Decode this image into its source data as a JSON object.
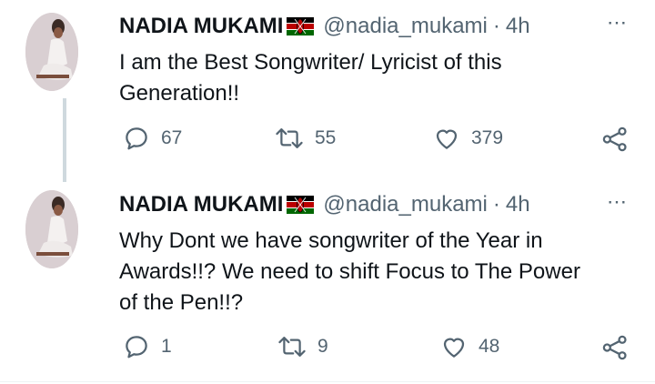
{
  "colors": {
    "text": "#0f1419",
    "secondary": "#536471",
    "thread_line": "#cfd9de"
  },
  "tweets": [
    {
      "author": {
        "name": "NADIA MUKAMI",
        "flag": "kenya-flag-emoji",
        "handle": "@nadia_mukami"
      },
      "separator": "·",
      "time": "4h",
      "more_icon": "⋯",
      "lines": [
        "I am the Best Songwriter/ Lyricist of this",
        "Generation!!"
      ],
      "stats": {
        "replies": "67",
        "retweets": "55",
        "likes": "379"
      }
    },
    {
      "author": {
        "name": "NADIA MUKAMI",
        "flag": "kenya-flag-emoji",
        "handle": "@nadia_mukami"
      },
      "separator": "·",
      "time": "4h",
      "more_icon": "⋯",
      "lines": [
        "Why Dont we have songwriter of the Year in",
        "Awards!!? We need to shift Focus to The Power",
        "of the Pen!!?"
      ],
      "stats": {
        "replies": "1",
        "retweets": "9",
        "likes": "48"
      }
    }
  ]
}
